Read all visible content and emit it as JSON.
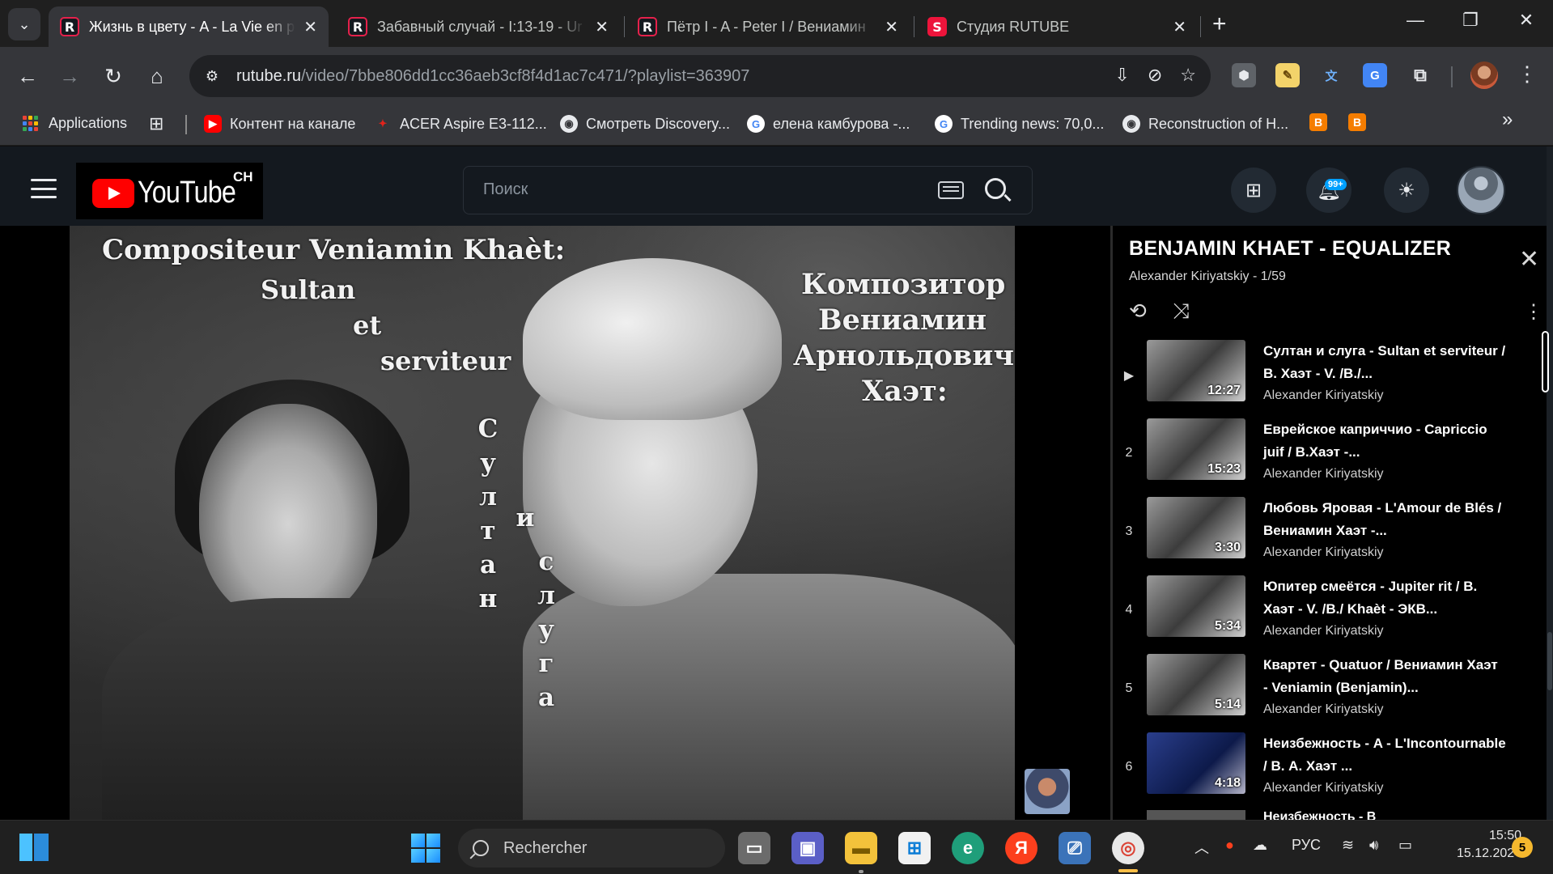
{
  "browser": {
    "tabs": [
      {
        "title": "Жизнь в цвету - A - La Vie en p",
        "icon": "rutube-icon",
        "active": true
      },
      {
        "title": "Забавный случай - I:13-19 - Ur",
        "icon": "rutube-icon",
        "active": false
      },
      {
        "title": "Пётр I - A - Peter I / Вениамин",
        "icon": "rutube-icon",
        "active": false
      },
      {
        "title": "Студия RUTUBE",
        "icon": "rutube-studio-icon",
        "active": false
      }
    ],
    "tab_close_glyph": "✕",
    "new_tab_glyph": "+",
    "url_host": "rutube.ru",
    "url_path": "/video/7bbe806dd1cc36aeb3cf8f4d1ac7c471/?playlist=363907",
    "bookmarks": [
      {
        "label": "Applications",
        "icon": "apps-grid-icon"
      },
      {
        "label": "",
        "icon": "tab-groups-icon"
      },
      {
        "label": "Контент на канале",
        "icon": "youtube-icon"
      },
      {
        "label": "ACER Aspire E3-112...",
        "icon": "acer-icon"
      },
      {
        "label": "Смотреть Discovery...",
        "icon": "globe-icon"
      },
      {
        "label": "елена камбурова -...",
        "icon": "google-icon"
      },
      {
        "label": "Trending news: 70,0...",
        "icon": "google-icon"
      },
      {
        "label": "Reconstruction of H...",
        "icon": "globe-icon"
      }
    ],
    "accent_color": "#35363a"
  },
  "header": {
    "logo_text": "YouTube",
    "logo_badge": "CH",
    "search_placeholder": "Поиск",
    "notifications_badge": "99+"
  },
  "video": {
    "overlay_title": "Compositeur Veniamin Khaèt:",
    "overlay_fr_1": "Sultan",
    "overlay_fr_2": "et",
    "overlay_fr_3": "serviteur",
    "overlay_ru_1": "Композитор",
    "overlay_ru_2": "Вениамин",
    "overlay_ru_3": "Арнольдович",
    "overlay_ru_4": "Хаэт:",
    "vertical_1": [
      "С",
      "у",
      "л",
      "т",
      "а",
      "н"
    ],
    "vertical_2": "и",
    "vertical_3": [
      "с",
      "л",
      "у",
      "г",
      "а"
    ]
  },
  "playlist": {
    "title": "BENJAMIN KHAET - EQUALIZER",
    "subtitle": "Alexander Kiriyatskiy - 1/59",
    "items": [
      {
        "index": "▶",
        "title": "Султан и слуга - Sultan et serviteur / В. Хаэт - V. /B./...",
        "author": "Alexander Kiriyatskiy",
        "duration": "12:27"
      },
      {
        "index": "2",
        "title": "Еврейское каприччио - Capriccio juif / В.Хаэт -...",
        "author": "Alexander Kiriyatskiy",
        "duration": "15:23"
      },
      {
        "index": "3",
        "title": "Любовь Яровая - L'Amour de Blés / Вениамин Хаэт -...",
        "author": "Alexander Kiriyatskiy",
        "duration": "3:30"
      },
      {
        "index": "4",
        "title": "Юпитер смеётся - Jupiter rit / В. Хаэт - V. /B./ Khaèt - ЭКВ...",
        "author": "Alexander Kiriyatskiy",
        "duration": "5:34"
      },
      {
        "index": "5",
        "title": "Квартет - Quatuor / Вениамин Хаэт - Veniamin (Benjamin)...",
        "author": "Alexander Kiriyatskiy",
        "duration": "5:14"
      },
      {
        "index": "6",
        "title": "Неизбежность - A - L'Incontournable / В. А. Хаэт ...",
        "author": "Alexander Kiriyatskiy",
        "duration": "4:18"
      }
    ],
    "partial_item_title": "Неизбежность - В"
  },
  "taskbar": {
    "search_label": "Rechercher",
    "language": "РУС",
    "time": "15:50",
    "date": "15.12.2024",
    "notification_count": "5"
  }
}
